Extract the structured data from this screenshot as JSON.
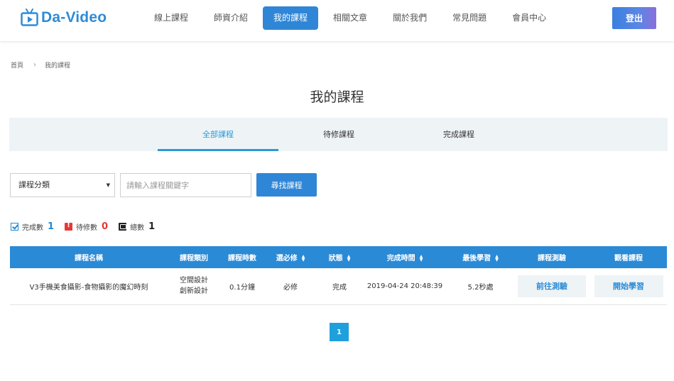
{
  "brand": {
    "name": "Da-Video",
    "color": "#2f8bd6",
    "icon": "tv-play-icon"
  },
  "nav": {
    "items": [
      {
        "label": "線上課程",
        "active": false
      },
      {
        "label": "師資介紹",
        "active": false
      },
      {
        "label": "我的課程",
        "active": true
      },
      {
        "label": "相關文章",
        "active": false
      },
      {
        "label": "關於我們",
        "active": false
      },
      {
        "label": "常見問題",
        "active": false
      },
      {
        "label": "會員中心",
        "active": false
      }
    ],
    "logout_label": "登出"
  },
  "breadcrumb": {
    "home": "首頁",
    "current": "我的課程"
  },
  "page_title": "我的課程",
  "tabs": [
    {
      "label": "全部課程",
      "active": true
    },
    {
      "label": "待修課程",
      "active": false
    },
    {
      "label": "完成課程",
      "active": false
    }
  ],
  "filters": {
    "category_select": "課程分類",
    "search_placeholder": "請輸入課程關鍵字",
    "search_button": "尋找課程"
  },
  "stats": {
    "completed": {
      "label": "完成數",
      "value": "1",
      "color": "#1f8ad6"
    },
    "pending": {
      "label": "待修數",
      "value": "0",
      "color": "#e53935"
    },
    "total": {
      "label": "總數",
      "value": "1",
      "color": "#222222"
    }
  },
  "table": {
    "headers": [
      "課程名稱",
      "課程類別",
      "課程時數",
      "選必修",
      "狀態",
      "完成時間",
      "最後學習",
      "課程測驗",
      "觀看課程"
    ],
    "rows": [
      {
        "name": "V3手機美食攝影-食物攝影的魔幻時刻",
        "category_1": "空間設計",
        "category_2": "創新設計",
        "hours": "0.1分鐘",
        "required": "必修",
        "status": "完成",
        "completed_at": "2019-04-24 20:48:39",
        "last_learned": "5.2秒處",
        "quiz_button": "前往測驗",
        "watch_button": "開始學習"
      }
    ]
  },
  "pagination": {
    "current": "1"
  },
  "colors": {
    "primary": "#2f86d6",
    "tab_active": "#2a9bd6",
    "table_header": "#2a8ad6",
    "page_active": "#1fa0dc"
  }
}
